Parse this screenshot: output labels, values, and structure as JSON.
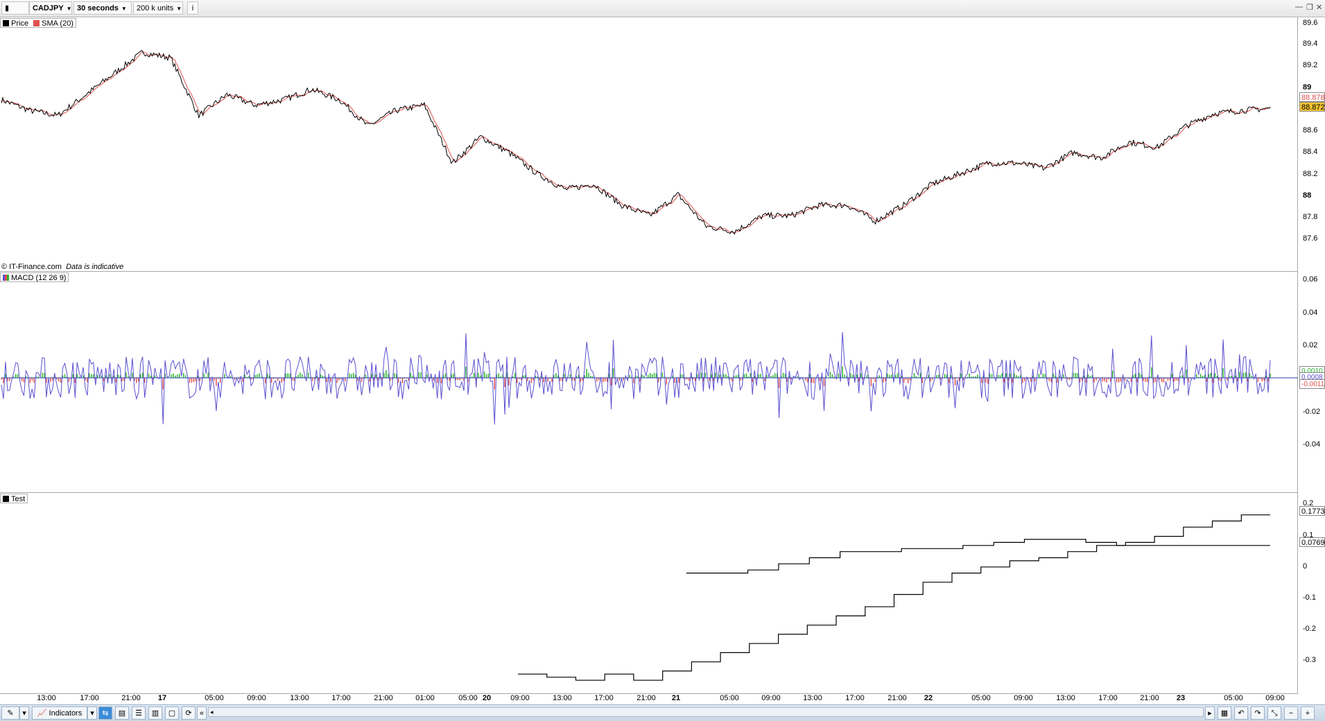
{
  "toolbar": {
    "symbol": "CADJPY",
    "timeframe": "30 seconds",
    "units": "200 k units",
    "info_icon": "i"
  },
  "price_panel": {
    "legend": [
      {
        "name": "Price",
        "color": "#000000"
      },
      {
        "name": "SMA (20)",
        "color": "#e05050"
      }
    ],
    "credit": "© IT-Finance.com",
    "credit_note": "Data is indicative",
    "y_ticks": [
      "89.6",
      "89.4",
      "89.2",
      "89",
      "88.6",
      "88.4",
      "88.2",
      "88",
      "87.8",
      "87.6"
    ],
    "last_values": [
      "88.878",
      "88.872"
    ]
  },
  "macd_panel": {
    "legend": "MACD (12 26 9)",
    "y_ticks": [
      "0.06",
      "0.04",
      "0.02",
      "-0.02",
      "-0.04"
    ],
    "last_values": [
      "0.0010",
      "0.0008",
      "-0.0011"
    ]
  },
  "test_panel": {
    "legend": "Test",
    "y_ticks": [
      "0.2",
      "0.1",
      "0",
      "-0.1",
      "-0.2",
      "-0.3"
    ],
    "last_values": [
      "0.1773",
      "0.0769"
    ]
  },
  "x_axis": {
    "ticks": [
      "13:00",
      "17:00",
      "21:00",
      "17",
      "05:00",
      "09:00",
      "13:00",
      "17:00",
      "21:00",
      "01:00",
      "05:00",
      "20",
      "09:00",
      "13:00",
      "17:00",
      "21:00",
      "21",
      "05:00",
      "09:00",
      "13:00",
      "17:00",
      "21:00",
      "22",
      "05:00",
      "09:00",
      "13:00",
      "17:00",
      "21:00",
      "23",
      "05:00",
      "09:00"
    ],
    "bold_ticks": [
      "17",
      "20",
      "21",
      "22",
      "23"
    ]
  },
  "bottombar": {
    "indicators_label": "Indicators"
  },
  "chart_data": [
    {
      "type": "line",
      "title": "",
      "series": [
        {
          "name": "Price",
          "values": [
            88.95,
            88.85,
            88.8,
            89.0,
            89.2,
            89.4,
            89.35,
            88.8,
            89.0,
            88.9,
            88.95,
            89.05,
            88.95,
            88.7,
            88.85,
            88.9,
            88.35,
            88.6,
            88.45,
            88.25,
            88.1,
            88.15,
            87.95,
            87.85,
            88.05,
            87.75,
            87.7,
            87.85,
            87.85,
            87.95,
            87.95,
            87.8,
            87.95,
            88.15,
            88.25,
            88.35,
            88.35,
            88.3,
            88.45,
            88.4,
            88.55,
            88.5,
            88.7,
            88.82,
            88.85,
            88.87
          ]
        },
        {
          "name": "SMA (20)",
          "values": []
        }
      ],
      "ylim": [
        87.45,
        89.7
      ]
    },
    {
      "type": "line",
      "title": "",
      "series": [
        {
          "name": "MACD (12 26 9)",
          "values": []
        }
      ],
      "ylim": [
        -0.065,
        0.065
      ]
    },
    {
      "type": "line",
      "title": "",
      "series": [
        {
          "name": "Test",
          "values": [
            -0.34,
            -0.35,
            -0.36,
            -0.34,
            -0.36,
            -0.33,
            -0.3,
            -0.27,
            -0.24,
            -0.21,
            -0.18,
            -0.15,
            -0.12,
            -0.08,
            -0.04,
            -0.01,
            0.01,
            0.03,
            0.04,
            0.06,
            0.08,
            0.09,
            0.11,
            0.14,
            0.16,
            0.18
          ]
        },
        {
          "name": "",
          "values": [
            -0.01,
            -0.01,
            0.0,
            0.02,
            0.04,
            0.06,
            0.06,
            0.07,
            0.07,
            0.08,
            0.09,
            0.1,
            0.1,
            0.09,
            0.08,
            0.08,
            0.08,
            0.08,
            0.08
          ]
        }
      ],
      "ylim": [
        -0.38,
        0.22
      ]
    }
  ]
}
